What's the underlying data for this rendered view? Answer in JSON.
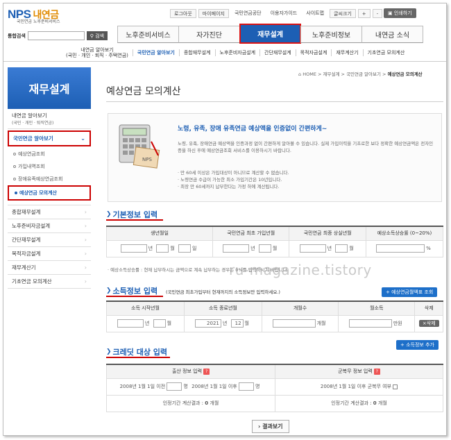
{
  "header": {
    "logo_main": "NPS",
    "logo_sub": "내연금",
    "logo_tagline": "국민연금 노후준비서비스",
    "toplinks": [
      "로그아웃",
      "마이페이지",
      "국민연금공단",
      "이용자가이드",
      "사이트맵",
      "글씨크기",
      "+",
      "-"
    ],
    "print_label": "인쇄하기",
    "search_label": "통합검색",
    "search_button": "검색"
  },
  "gnb": [
    "노후준비서비스",
    "자가진단",
    "재무설계",
    "노후준비정보",
    "내연금 소식"
  ],
  "subnav": {
    "first": "내연금 알아보기\n(국민 · 개인 · 퇴직 · 주택연금)",
    "items": [
      "국민연금 알아보기",
      "종합재무설계",
      "노후준비자금설계",
      "간단재무설계",
      "목적자금설계",
      "재무계산기",
      "기초연금 모의계산"
    ]
  },
  "lnb": {
    "title": "재무설계",
    "item1": "내연금 알아보기",
    "item1_sub": "(국민 · 개인 · 퇴직연금)",
    "item2": "국민연금 알아보기",
    "subs": [
      "예상연금조회",
      "가입내역조회",
      "장애유족예상연금조회",
      "예상연금 모의계산"
    ],
    "others": [
      "종합재무설계",
      "노후준비자금설계",
      "간단재무설계",
      "목적자금설계",
      "재무계산기",
      "기초연금 모의계산"
    ]
  },
  "breadcrumb": [
    "HOME",
    "재무설계",
    "국민연금 알아보기",
    "예상연금 모의계산"
  ],
  "page_title": "예상연금 모의계산",
  "intro": {
    "headline": "노령, 유족, 장애 유족연금 예상액을 인증없이 간편하게~",
    "body": "노령, 유족, 장애연금 예상액을 인증과정 없이 간편하게 알아볼 수 있습니다. 실제 가입이력을 기초로한 보다 정확한 예상연금액은 전자인증을 하신 후에 예상연금조회 서비스를 이용하시기 바랍니다.",
    "list": [
      "· 만 60세 이상은 가입대상이 아니므로 계산할 수 없습니다.",
      "· 노령연금 수급이 가능한 최소 가입기간은 10년입니다.",
      "· 최장 만 60세까지 납부한다는 가정 하에 계산됩니다."
    ],
    "calculator_label": "NPS"
  },
  "basic": {
    "heading": "기본정보 입력",
    "headers": [
      "생년월일",
      "국민연금 최초 가입년월",
      "국민연금 최종 상실년월",
      "예상소득상승률 (0~20%)"
    ],
    "units": {
      "year": "년",
      "month": "월",
      "day": "일",
      "percent": "%"
    },
    "note": "· 예상소득상승률 : 현재 납부하시는 금액으로 계속 납부하는 경우는 0%를 입력하시기 바랍니다."
  },
  "income": {
    "heading": "소득정보 입력",
    "note": "(국민연금 최초가입부터 현재까지의 소득정보만 입력하세요.)",
    "history_button": "예상연금월액표 조회",
    "headers": [
      "소득 시작년월",
      "소득 종료년월",
      "개월수",
      "월소득",
      "삭제"
    ],
    "end_year": "2021",
    "end_month": "12",
    "unit_months": "개월",
    "unit_won": "만원",
    "delete_label": "삭제",
    "add_button": "소득정보 추가"
  },
  "credit": {
    "heading": "크레딧 대상 입력",
    "headers": [
      "출산 정보 입력",
      "군복무 정보 입력"
    ],
    "before": "2008년 1월 1일 이전",
    "after": "2008년 1월 1일 이후",
    "unit_persons": "명",
    "military": "2008년 1월 1일 이후 군복무 여부",
    "result1_label": "인정기간 계산결과 :",
    "result1_value": "0",
    "result_unit": "개월",
    "result2_label": "인정기간 계산결과 :",
    "result2_value": "0"
  },
  "result_button": "결과보기",
  "watermark": "ru-magazine.tistory"
}
